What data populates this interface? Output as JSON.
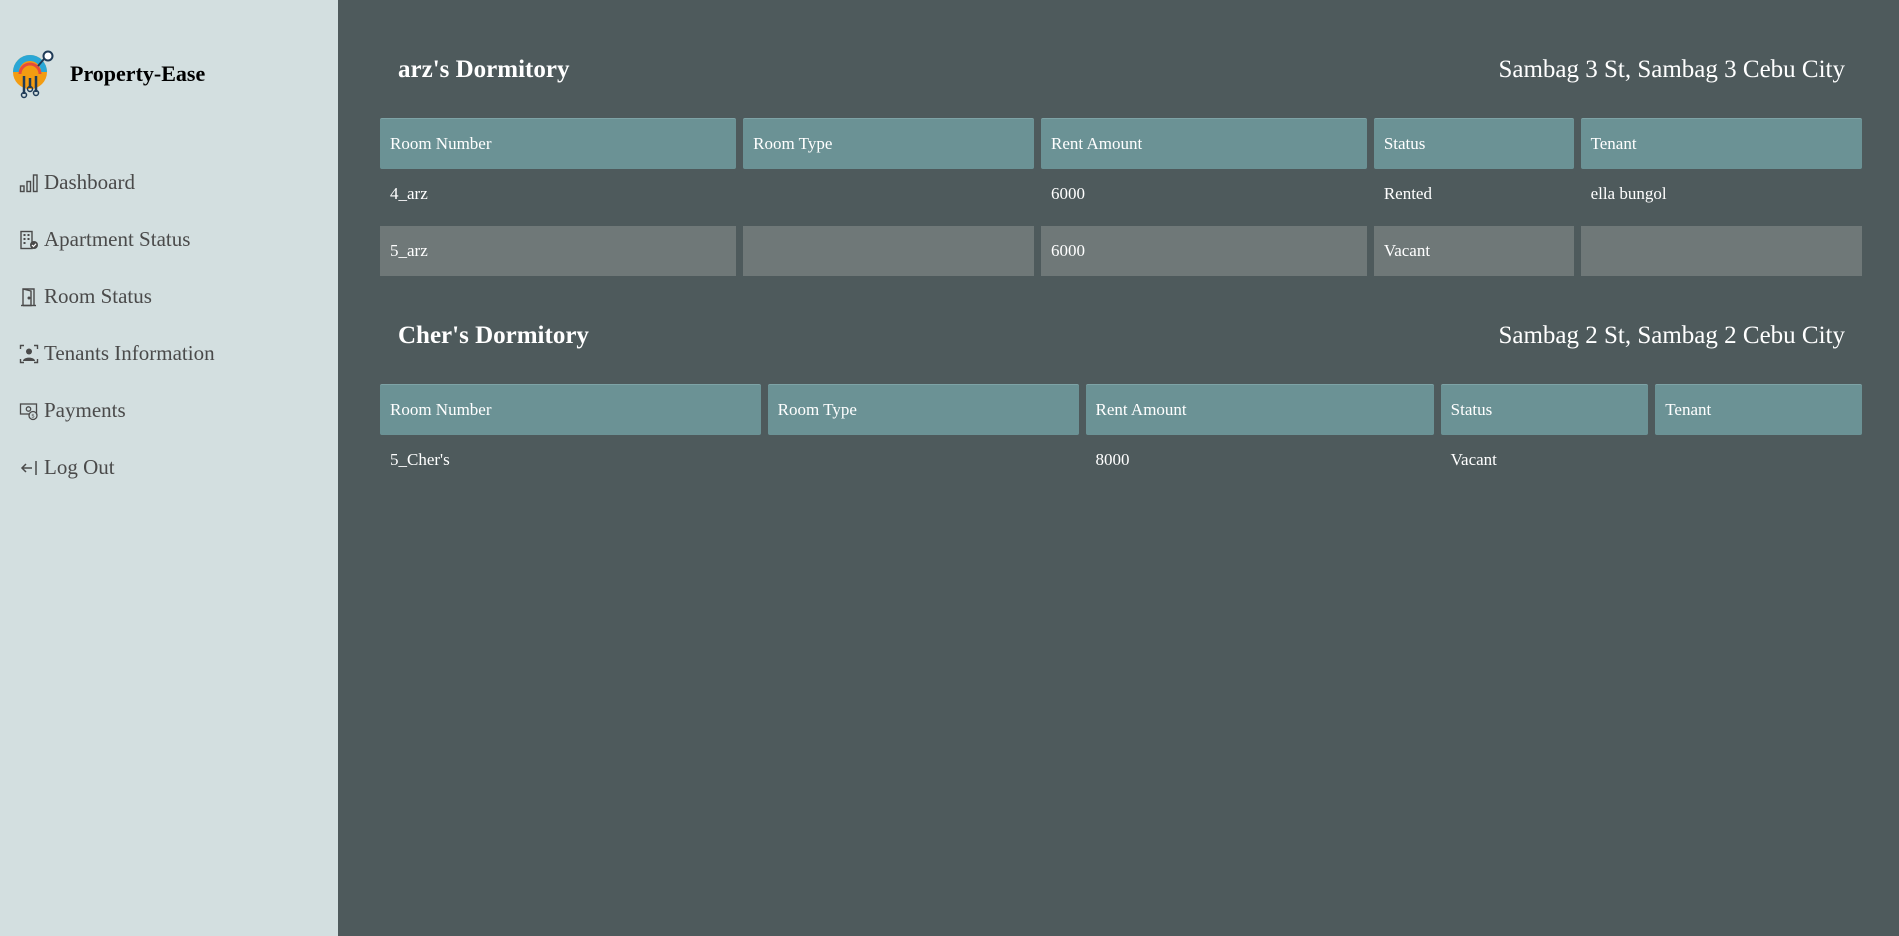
{
  "app": {
    "name": "Property-Ease"
  },
  "sidebar": {
    "items": [
      {
        "label": "Dashboard",
        "icon": "bar-chart-icon"
      },
      {
        "label": "Apartment Status",
        "icon": "building-check-icon"
      },
      {
        "label": "Room Status",
        "icon": "door-icon"
      },
      {
        "label": "Tenants Information",
        "icon": "person-badge-icon"
      },
      {
        "label": "Payments",
        "icon": "cash-icon"
      },
      {
        "label": "Log Out",
        "icon": "logout-arrow-icon"
      }
    ]
  },
  "table_headers": [
    "Room Number",
    "Room Type",
    "Rent Amount",
    "Status",
    "Tenant"
  ],
  "dormitories": [
    {
      "name": "arz's Dormitory",
      "address": "Sambag 3 St, Sambag 3 Cebu City",
      "rooms": [
        {
          "room_number": "4_arz",
          "room_type": "",
          "rent_amount": "6000",
          "status": "Rented",
          "tenant": "ella bungol"
        },
        {
          "room_number": "5_arz",
          "room_type": "",
          "rent_amount": "6000",
          "status": "Vacant",
          "tenant": ""
        }
      ]
    },
    {
      "name": "Cher's Dormitory",
      "address": "Sambag 2 St, Sambag 2 Cebu City",
      "rooms": [
        {
          "room_number": "5_Cher's",
          "room_type": "",
          "rent_amount": "8000",
          "status": "Vacant",
          "tenant": ""
        }
      ]
    }
  ],
  "colors": {
    "sidebar_bg": "#d3dfe0",
    "main_bg": "#4e5a5c",
    "header_bg": "#6b9295",
    "shaded_row": "#6f7878"
  }
}
